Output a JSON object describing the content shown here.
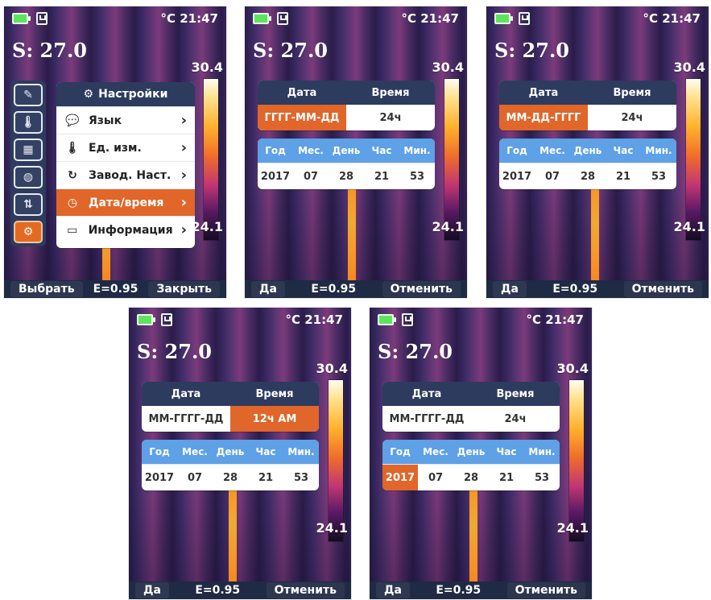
{
  "common": {
    "temp_unit_time": "°C 21:47",
    "spot_label": "S: 27.0",
    "scale_max": "30.4",
    "scale_min": "24.1",
    "emissivity": "E=0.95"
  },
  "screens": [
    {
      "bottom_left": "Выбрать",
      "bottom_right": "Закрыть",
      "menu": {
        "title": "Настройки",
        "items": [
          {
            "label": "Язык",
            "icon": "language-icon"
          },
          {
            "label": "Ед. изм.",
            "icon": "thermometer-icon"
          },
          {
            "label": "Завод. Наст.",
            "icon": "reset-icon"
          },
          {
            "label": "Дата/время",
            "icon": "clock-icon",
            "selected": true
          },
          {
            "label": "Информация",
            "icon": "info-icon"
          }
        ],
        "rail_icons": [
          "edit-icon",
          "thermometer-icon",
          "image-icon",
          "palette-icon",
          "temperature-range-icon",
          "settings-icon"
        ]
      }
    },
    {
      "bottom_left": "Да",
      "bottom_right": "Отменить",
      "date_header": {
        "date": "Дата",
        "time": "Время"
      },
      "date_values": {
        "date": "ГГГГ-ММ-ДД",
        "time": "24ч",
        "highlight": "date"
      },
      "grid": {
        "headers": [
          "Год",
          "Мес.",
          "День",
          "Час",
          "Мин."
        ],
        "values": [
          "2017",
          "07",
          "28",
          "21",
          "53"
        ],
        "highlight_index": -1
      }
    },
    {
      "bottom_left": "Да",
      "bottom_right": "Отменить",
      "date_header": {
        "date": "Дата",
        "time": "Время"
      },
      "date_values": {
        "date": "ММ-ДД-ГГГГ",
        "time": "24ч",
        "highlight": "date"
      },
      "grid": {
        "headers": [
          "Год",
          "Мес.",
          "День",
          "Час",
          "Мин."
        ],
        "values": [
          "2017",
          "07",
          "28",
          "21",
          "53"
        ],
        "highlight_index": -1
      }
    },
    {
      "bottom_left": "Да",
      "bottom_right": "Отменить",
      "date_header": {
        "date": "Дата",
        "time": "Время"
      },
      "date_values": {
        "date": "ММ-ГГГГ-ДД",
        "time": "12ч AM",
        "highlight": "time"
      },
      "grid": {
        "headers": [
          "Год",
          "Мес.",
          "День",
          "Час",
          "Мин."
        ],
        "values": [
          "2017",
          "07",
          "28",
          "21",
          "53"
        ],
        "highlight_index": -1
      }
    },
    {
      "bottom_left": "Да",
      "bottom_right": "Отменить",
      "date_header": {
        "date": "Дата",
        "time": "Время"
      },
      "date_values": {
        "date": "ММ-ГГГГ-ДД",
        "time": "24ч",
        "highlight": "none"
      },
      "grid": {
        "headers": [
          "Год",
          "Мес.",
          "День",
          "Час",
          "Мин."
        ],
        "values": [
          "2017",
          "07",
          "28",
          "21",
          "53"
        ],
        "highlight_index": 0
      }
    }
  ],
  "colors": {
    "accent_orange": "#e0662a",
    "panel_navy": "#2d3b5f",
    "grid_blue": "#5ea1e6",
    "bottom_bar": "#1f2a44"
  }
}
